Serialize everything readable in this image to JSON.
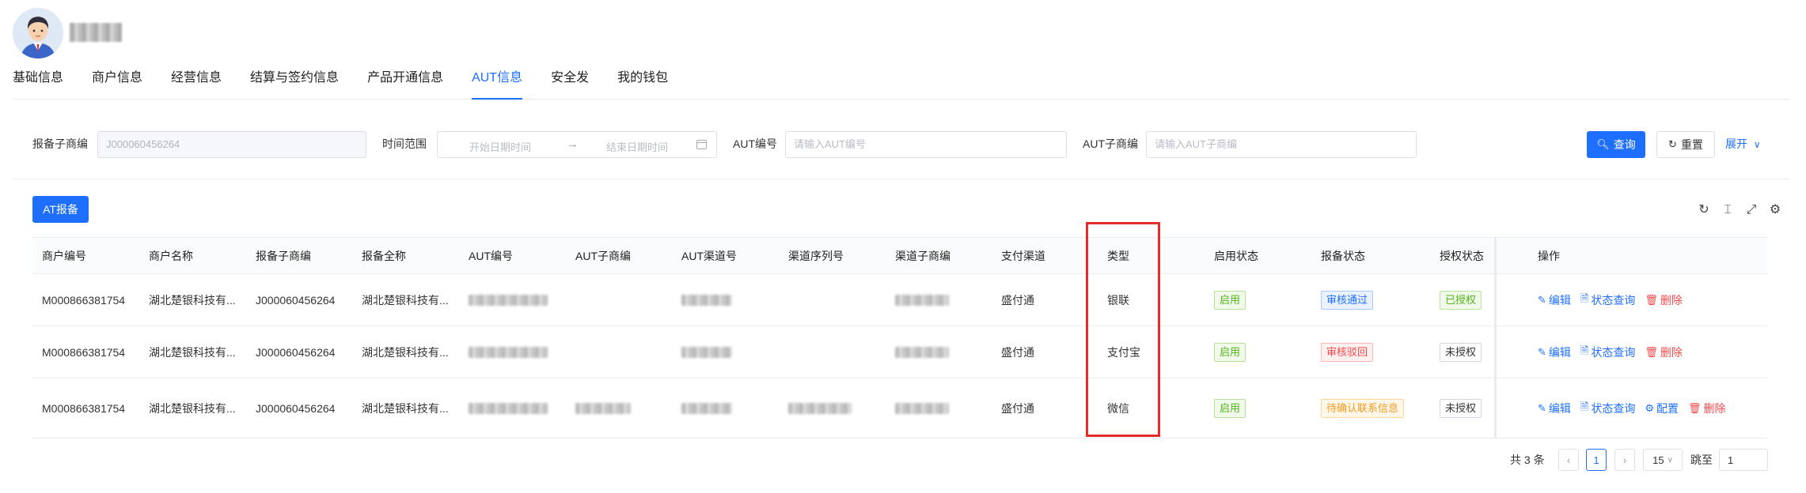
{
  "header": {
    "user_name": "用户"
  },
  "tabs": [
    {
      "label": "基础信息",
      "active": false
    },
    {
      "label": "商户信息",
      "active": false
    },
    {
      "label": "经营信息",
      "active": false
    },
    {
      "label": "结算与签约信息",
      "active": false
    },
    {
      "label": "产品开通信息",
      "active": false
    },
    {
      "label": "AUT信息",
      "active": true
    },
    {
      "label": "安全发",
      "active": false
    },
    {
      "label": "我的钱包",
      "active": false
    }
  ],
  "filters": {
    "sub_merchant_label": "报备子商编",
    "sub_merchant_value": "J000060456264",
    "time_range_label": "时间范围",
    "start_placeholder": "开始日期时间",
    "range_separator": "→",
    "end_placeholder": "结束日期时间",
    "aut_no_label": "AUT编号",
    "aut_no_placeholder": "请输入AUT编号",
    "aut_sub_label": "AUT子商编",
    "aut_sub_placeholder": "请输入AUT子商编",
    "search_label": "查询",
    "reset_label": "重置",
    "expand_label": "展开"
  },
  "toolbar": {
    "at_report_label": "AT报备"
  },
  "table": {
    "columns": [
      "商户编号",
      "商户名称",
      "报备子商编",
      "报备全称",
      "AUT编号",
      "AUT子商编",
      "AUT渠道号",
      "渠道序列号",
      "渠道子商编",
      "支付渠道",
      "类型",
      "启用状态",
      "报备状态",
      "授权状态",
      "操作"
    ],
    "rows": [
      {
        "merchant_no": "M000866381754",
        "merchant_name": "湖北楚银科技有...",
        "sub_merchant": "J000060456264",
        "full_name": "湖北楚银科技有...",
        "pay_channel": "盛付通",
        "type": "银联",
        "enable_status": "启用",
        "report_status": "审核通过",
        "auth_status": "已授权",
        "ops": [
          "编辑",
          "状态查询",
          "删除"
        ]
      },
      {
        "merchant_no": "M000866381754",
        "merchant_name": "湖北楚银科技有...",
        "sub_merchant": "J000060456264",
        "full_name": "湖北楚银科技有...",
        "pay_channel": "盛付通",
        "type": "支付宝",
        "enable_status": "启用",
        "report_status": "审核驳回",
        "auth_status": "未授权",
        "ops": [
          "编辑",
          "状态查询",
          "删除"
        ]
      },
      {
        "merchant_no": "M000866381754",
        "merchant_name": "湖北楚银科技有...",
        "sub_merchant": "J000060456264",
        "full_name": "湖北楚银科技有...",
        "pay_channel": "盛付通",
        "type": "微信",
        "enable_status": "启用",
        "report_status": "待确认联系信息",
        "auth_status": "未授权",
        "ops": [
          "编辑",
          "状态查询",
          "配置",
          "删除"
        ]
      }
    ]
  },
  "pagination": {
    "total": "共 3 条",
    "current_page": "1",
    "page_size": "15",
    "jump_label": "跳至",
    "jump_value": "1"
  },
  "colors": {
    "primary": "#1e6fff",
    "danger": "#f5484a",
    "success": "#52b41a",
    "warning": "#f59b1f",
    "highlight": "#e62b2b"
  }
}
